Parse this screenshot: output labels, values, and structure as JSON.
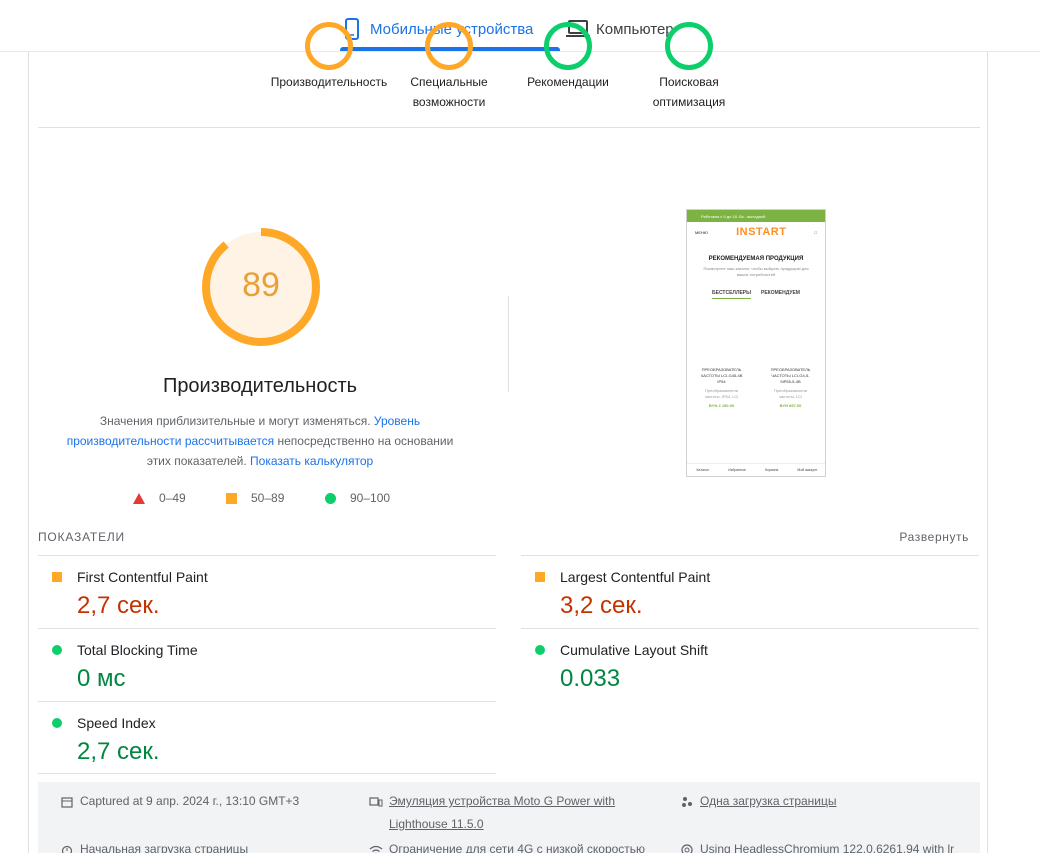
{
  "tabs": [
    {
      "label": "Мобильные устройства",
      "icon": "phone-icon",
      "active": true
    },
    {
      "label": "Компьютер",
      "icon": "laptop-icon",
      "active": false
    }
  ],
  "categories": [
    {
      "label_line1": "Производительность",
      "label_line2": "",
      "color": "#ffa726"
    },
    {
      "label_line1": "Специальные",
      "label_line2": "возможности",
      "color": "#ffa726"
    },
    {
      "label_line1": "Рекомендации",
      "label_line2": "",
      "color": "#0cce6b"
    },
    {
      "label_line1": "Поисковая",
      "label_line2": "оптимизация",
      "color": "#0cce6b"
    }
  ],
  "performance": {
    "score": "89",
    "score_fraction": 0.89,
    "title": "Производительность",
    "desc_part1": "Значения приблизительные и могут изменяться. ",
    "desc_link1": "Уровень производительности рассчитывается",
    "desc_part2": " непосредственно на основании этих показателей. ",
    "desc_link2": "Показать калькулятор"
  },
  "legend": [
    {
      "range": "0–49",
      "shape": "triangle",
      "color": "#e53935"
    },
    {
      "range": "50–89",
      "shape": "square",
      "color": "#ffa726"
    },
    {
      "range": "90–100",
      "shape": "circle",
      "color": "#0cce6b"
    }
  ],
  "thumbnail": {
    "topbar": "Работаем с 9 до 18. Вс - выходной",
    "menu": "МЕНЮ",
    "logo": "INSTART",
    "heading": "РЕКОМЕНДУЕМАЯ ПРОДУКЦИЯ",
    "subheading": "Посмотрите наш каталог, чтобы выбрать продукцию для ваших потребностей",
    "tab1": "БЕСТСЕЛЛЕРЫ",
    "tab2": "РЕКОМЕНДУЕМ",
    "product1_name": "ПРЕОБРАЗОВАТЕЛЬ ЧАСТОТЫ LCI-G45-4B IP54",
    "product1_sub": "Преобразователи частоты, IP54, LCI",
    "product1_price": "BYN 2 150.00",
    "product2_name": "ПРЕОБРАЗОВАТЕЛЬ ЧАСТОТЫ LCI-G4-5-5IP55-5-4B",
    "product2_sub": "Преобразователи частоты, LCI",
    "product2_price": "BYN 897.00",
    "nav": [
      "Каталог",
      "Избранное",
      "Корзина",
      "Мой аккаунт"
    ]
  },
  "metrics_section": {
    "heading": "ПОКАЗАТЕЛИ",
    "expand_label": "Развернуть"
  },
  "metrics": [
    {
      "name": "First Contentful Paint",
      "value": "2,7 сек.",
      "status": "average"
    },
    {
      "name": "Largest Contentful Paint",
      "value": "3,2 сек.",
      "status": "average"
    },
    {
      "name": "Total Blocking Time",
      "value": "0 мс",
      "status": "good"
    },
    {
      "name": "Cumulative Layout Shift",
      "value": "0.033",
      "status": "good"
    },
    {
      "name": "Speed Index",
      "value": "2,7 сек.",
      "status": "good"
    }
  ],
  "info": {
    "captured": "Captured at 9 апр. 2024 г., 13:10 GMT+3",
    "emulation": "Эмуляция устройства Moto G Power with",
    "emulation2": "Lighthouse 11.5.0",
    "single_load": "Одна загрузка страницы",
    "initial_load": "Начальная загрузка страницы",
    "throttling": "Ограничение для сети 4G с низкой скоростью",
    "browser": "Using HeadlessChromium 122.0.6261.94 with lr"
  },
  "colors": {
    "accent": "#1a73e8",
    "average": "#ffa726",
    "good": "#0cce6b",
    "bad_text": "#c33300",
    "good_text": "#018642"
  }
}
